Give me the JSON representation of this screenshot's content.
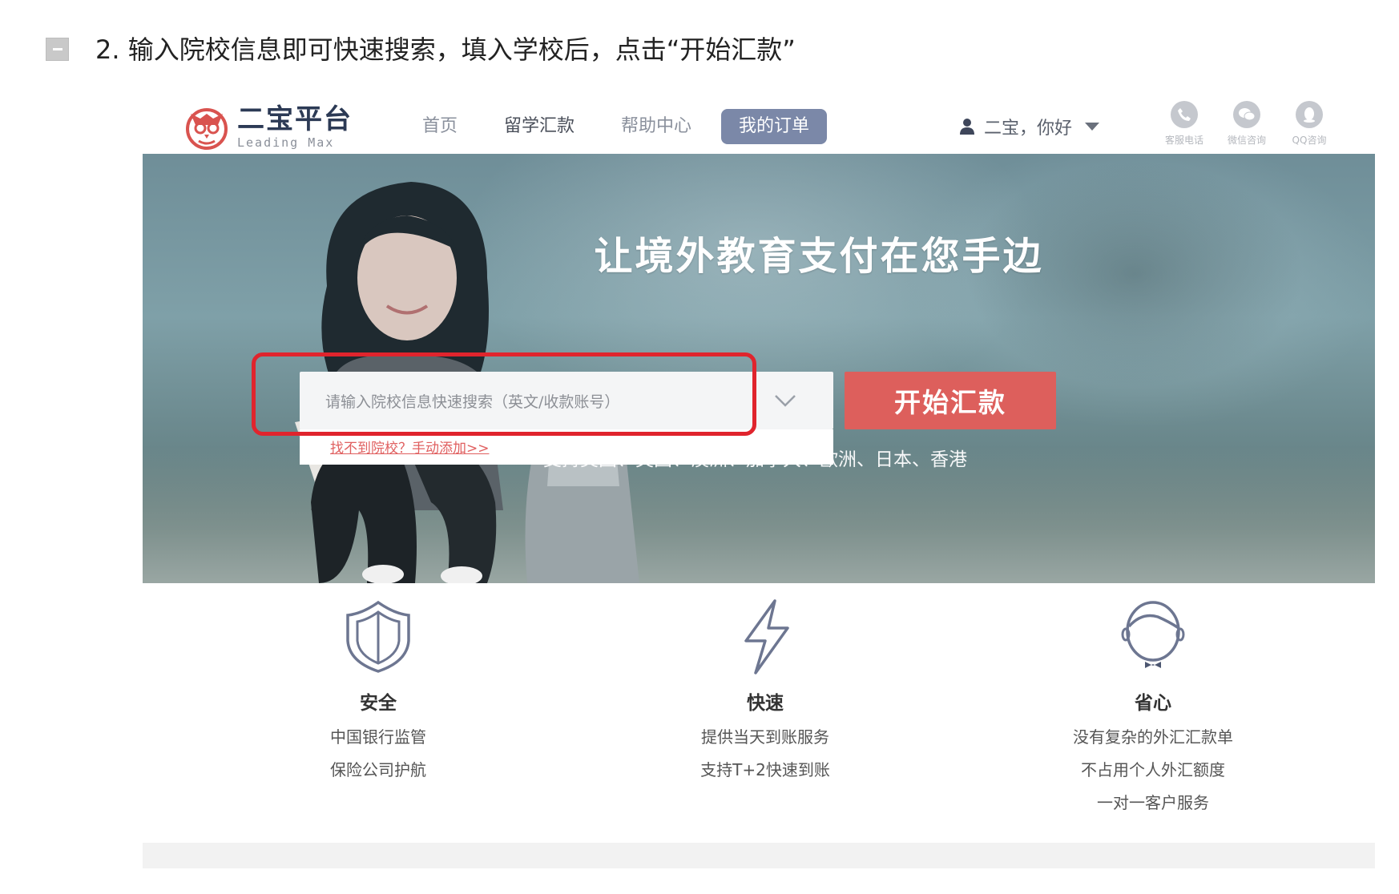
{
  "instruction": {
    "text": "2. 输入院校信息即可快速搜索，填入学校后，点击“开始汇款”"
  },
  "header": {
    "logo_cn": "二宝平台",
    "logo_en": "Leading Max",
    "nav": [
      {
        "label": "首页"
      },
      {
        "label": "留学汇款"
      },
      {
        "label": "帮助中心"
      },
      {
        "label": "我的订单"
      }
    ],
    "user_greeting": "二宝，你好",
    "contacts": [
      {
        "label": "客服电话",
        "icon": "phone-icon"
      },
      {
        "label": "微信咨询",
        "icon": "wechat-icon"
      },
      {
        "label": "QQ咨询",
        "icon": "qq-icon"
      }
    ]
  },
  "hero": {
    "headline": "让境外教育支付在您手边",
    "search_placeholder": "请输入院校信息快速搜索（英文/收款账号）",
    "manual_add_link": "找不到院校？手动添加>>",
    "start_button": "开始汇款",
    "support_text": "支持美国、英国、澳洲、加拿大、欧洲、日本、香港"
  },
  "features": [
    {
      "title": "安全",
      "lines": [
        "中国银行监管",
        "保险公司护航"
      ],
      "icon": "shield-icon"
    },
    {
      "title": "快速",
      "lines": [
        "提供当天到账服务",
        "支持T+2快速到账"
      ],
      "icon": "lightning-icon"
    },
    {
      "title": "省心",
      "lines": [
        "没有复杂的外汇汇款单",
        "不占用个人外汇额度",
        "一对一客户服务"
      ],
      "icon": "service-person-icon"
    }
  ],
  "colors": {
    "accent_red": "#dd5f5c",
    "highlight_red": "#e0242d",
    "nav_active": "#7b88a8",
    "brand_navy": "#2c3a55"
  }
}
